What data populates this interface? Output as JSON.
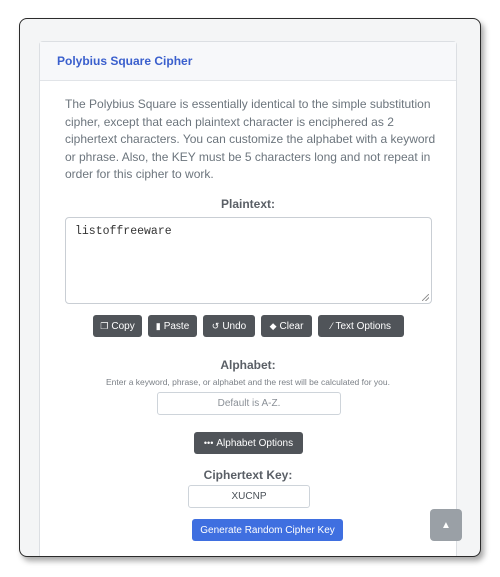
{
  "card": {
    "title": "Polybius Square Cipher"
  },
  "description": "The Polybius Square is essentially identical to the simple substitution cipher, except that each plaintext character is enciphered as 2 ciphertext characters. You can customize the alphabet with a keyword or phrase. Also, the KEY must be 5 characters long and not repeat in order for this cipher to work.",
  "plaintext": {
    "label": "Plaintext:",
    "value": "listoffreeware"
  },
  "toolbar": {
    "copy": "Copy",
    "paste": "Paste",
    "undo": "Undo",
    "clear": "Clear",
    "text_options": "Text Options"
  },
  "alphabet": {
    "label": "Alphabet:",
    "hint": "Enter a keyword, phrase, or alphabet and the rest will be calculated for you.",
    "placeholder": "Default is A-Z.",
    "options_label": "Alphabet Options"
  },
  "cipher_key": {
    "label": "Ciphertext Key:",
    "value": "XUCNP",
    "generate_label": "Generate Random Cipher Key"
  },
  "colors": {
    "accent": "#3f6fe0",
    "title": "#3a5fcd",
    "button": "#505459"
  }
}
